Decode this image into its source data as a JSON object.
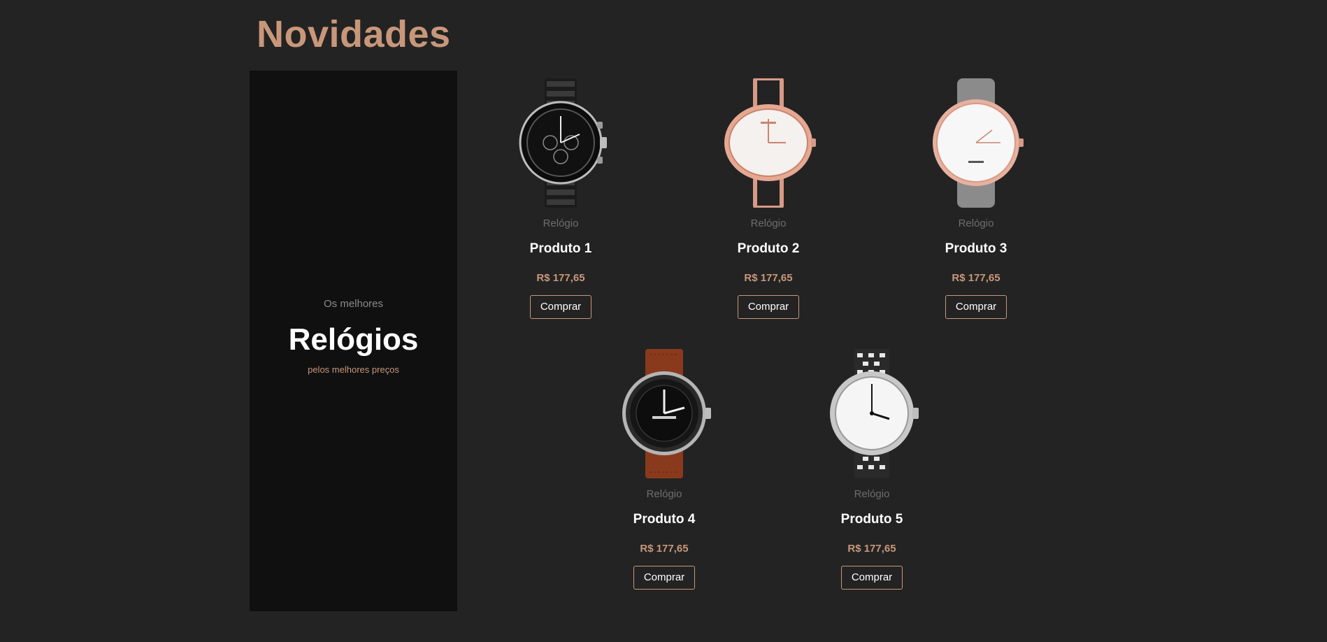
{
  "header": {
    "title": "Novidades"
  },
  "promo": {
    "pre": "Os melhores",
    "title": "Relógios",
    "post": "pelos melhores preços"
  },
  "products": [
    {
      "category": "Relógio",
      "name": "Produto 1",
      "price": "R$ 177,65",
      "button": "Comprar",
      "image": "black-chronograph-watch"
    },
    {
      "category": "Relógio",
      "name": "Produto 2",
      "price": "R$ 177,65",
      "button": "Comprar",
      "image": "rose-gold-oval-watch"
    },
    {
      "category": "Relógio",
      "name": "Produto 3",
      "price": "R$ 177,65",
      "button": "Comprar",
      "image": "rose-gold-grey-strap-watch"
    },
    {
      "category": "Relógio",
      "name": "Produto 4",
      "price": "R$ 177,65",
      "button": "Comprar",
      "image": "diver-brown-leather-watch"
    },
    {
      "category": "Relógio",
      "name": "Produto 5",
      "price": "R$ 177,65",
      "button": "Comprar",
      "image": "white-dial-houndstooth-watch"
    }
  ],
  "colors": {
    "background": "#232323",
    "panel": "#101010",
    "accent": "#c8977a"
  }
}
